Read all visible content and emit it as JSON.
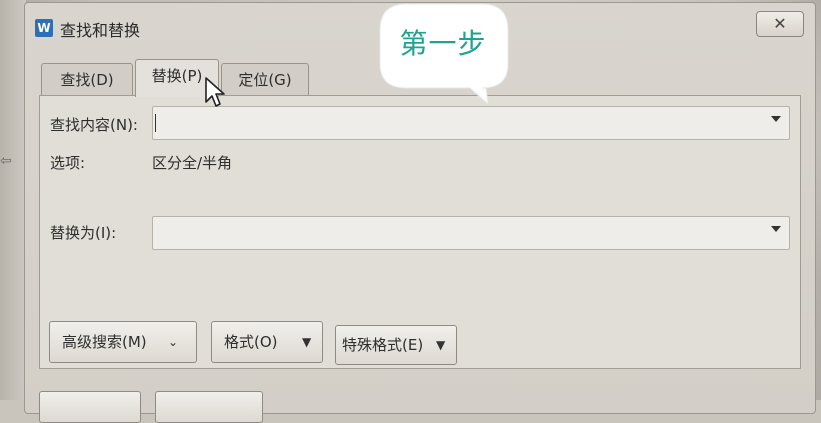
{
  "window": {
    "title": "查找和替换",
    "close_label": "✕"
  },
  "tabs": [
    {
      "label": "查找(D)",
      "active": false
    },
    {
      "label": "替换(P)",
      "active": true
    },
    {
      "label": "定位(G)",
      "active": false
    }
  ],
  "find": {
    "label": "查找内容(N):",
    "value": ""
  },
  "options": {
    "label": "选项:",
    "value": "区分全/半角"
  },
  "replace": {
    "label": "替换为(I):",
    "value": ""
  },
  "buttons": {
    "advanced_search": "高级搜索(M)",
    "format": "格式(O)",
    "special_format": "特殊格式(E)"
  },
  "annotation": {
    "bubble_text": "第一步",
    "color": "#1fa28f"
  },
  "icons": {
    "app": "wps-writer-icon",
    "close": "close-icon",
    "dropdown": "chevron-down-icon",
    "expand": "double-chevron-icon",
    "cursor": "mouse-pointer-icon"
  }
}
